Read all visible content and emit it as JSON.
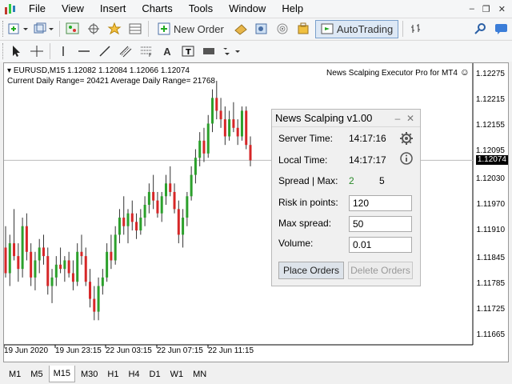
{
  "menubar": {
    "items": [
      "File",
      "View",
      "Insert",
      "Charts",
      "Tools",
      "Window",
      "Help"
    ],
    "win_controls": [
      "‒",
      "❐",
      "✕"
    ]
  },
  "toolbar1": {
    "new_order_label": "New Order",
    "autotrading_label": "AutoTrading"
  },
  "toolbar2": {
    "text_tool_label": "A"
  },
  "chart": {
    "symbol_line": "EURUSD,M15  1.12082 1.12084 1.12066 1.12074",
    "range_line": "Current Daily Range= 20421    Average Daily Range= 21768",
    "ea_label": "News Scalping Executor Pro for MT4",
    "ea_status_icon": "☺",
    "price_ticks": [
      "1.12275",
      "1.12215",
      "1.12155",
      "1.12095",
      "1.12030",
      "1.11970",
      "1.11910",
      "1.11845",
      "1.11785",
      "1.11725",
      "1.11665"
    ],
    "current_price": "1.12074",
    "time_ticks": [
      "19 Jun 2020",
      "19 Jun 23:15",
      "22 Jun 03:15",
      "22 Jun 07:15",
      "22 Jun 11:15"
    ],
    "colors": {
      "bull": "#2ca02c",
      "bear": "#d62728",
      "wick": "#333333",
      "hline": "#bbbbbb"
    }
  },
  "chart_data": {
    "type": "candlestick",
    "ylim": [
      1.11665,
      1.12275
    ],
    "candles": [
      [
        1.1187,
        1.1192,
        1.118,
        1.1181
      ],
      [
        1.1181,
        1.119,
        1.1178,
        1.1188
      ],
      [
        1.1188,
        1.1196,
        1.1184,
        1.1185
      ],
      [
        1.1185,
        1.1188,
        1.1179,
        1.1182
      ],
      [
        1.1182,
        1.1194,
        1.118,
        1.1192
      ],
      [
        1.1192,
        1.1195,
        1.1184,
        1.1186
      ],
      [
        1.1186,
        1.1188,
        1.1178,
        1.118
      ],
      [
        1.118,
        1.1186,
        1.1177,
        1.1184
      ],
      [
        1.1184,
        1.1189,
        1.1181,
        1.1187
      ],
      [
        1.1187,
        1.119,
        1.1183,
        1.1185
      ],
      [
        1.1185,
        1.1187,
        1.1176,
        1.1178
      ],
      [
        1.1178,
        1.1182,
        1.1174,
        1.118
      ],
      [
        1.118,
        1.1185,
        1.1178,
        1.1183
      ],
      [
        1.1183,
        1.1187,
        1.1181,
        1.1182
      ],
      [
        1.1182,
        1.1185,
        1.1179,
        1.1184
      ],
      [
        1.1184,
        1.1186,
        1.118,
        1.1181
      ],
      [
        1.1181,
        1.1184,
        1.1177,
        1.1179
      ],
      [
        1.1179,
        1.1188,
        1.1178,
        1.1186
      ],
      [
        1.1186,
        1.119,
        1.1183,
        1.1185
      ],
      [
        1.1185,
        1.1187,
        1.1178,
        1.1179
      ],
      [
        1.1179,
        1.1182,
        1.1173,
        1.1175
      ],
      [
        1.1175,
        1.1178,
        1.117,
        1.1172
      ],
      [
        1.1172,
        1.118,
        1.117,
        1.1178
      ],
      [
        1.1178,
        1.1182,
        1.1176,
        1.118
      ],
      [
        1.118,
        1.1188,
        1.1179,
        1.1186
      ],
      [
        1.1186,
        1.119,
        1.1182,
        1.1184
      ],
      [
        1.1184,
        1.1192,
        1.1183,
        1.119
      ],
      [
        1.119,
        1.1196,
        1.1188,
        1.1194
      ],
      [
        1.1194,
        1.1199,
        1.119,
        1.1192
      ],
      [
        1.1192,
        1.1196,
        1.1188,
        1.1195
      ],
      [
        1.1195,
        1.1198,
        1.1191,
        1.1193
      ],
      [
        1.1193,
        1.1195,
        1.1189,
        1.1191
      ],
      [
        1.1191,
        1.1196,
        1.119,
        1.1194
      ],
      [
        1.1194,
        1.1199,
        1.1192,
        1.1197
      ],
      [
        1.1197,
        1.1202,
        1.1195,
        1.12
      ],
      [
        1.12,
        1.1204,
        1.1196,
        1.1198
      ],
      [
        1.1198,
        1.12,
        1.1194,
        1.1195
      ],
      [
        1.1195,
        1.12,
        1.1193,
        1.1199
      ],
      [
        1.1199,
        1.1204,
        1.1197,
        1.1202
      ],
      [
        1.1202,
        1.1206,
        1.1199,
        1.12
      ],
      [
        1.12,
        1.1202,
        1.1195,
        1.1196
      ],
      [
        1.1196,
        1.1198,
        1.1188,
        1.119
      ],
      [
        1.119,
        1.1196,
        1.1187,
        1.1194
      ],
      [
        1.1194,
        1.12,
        1.1192,
        1.1199
      ],
      [
        1.1199,
        1.1206,
        1.1198,
        1.1204
      ],
      [
        1.1204,
        1.121,
        1.1202,
        1.1208
      ],
      [
        1.1208,
        1.1214,
        1.1206,
        1.1212
      ],
      [
        1.1212,
        1.1215,
        1.1207,
        1.1209
      ],
      [
        1.1209,
        1.1218,
        1.1208,
        1.1216
      ],
      [
        1.1216,
        1.1224,
        1.1214,
        1.1222
      ],
      [
        1.1222,
        1.1226,
        1.1217,
        1.1219
      ],
      [
        1.1219,
        1.1222,
        1.1215,
        1.1217
      ],
      [
        1.1217,
        1.122,
        1.1211,
        1.1213
      ],
      [
        1.1213,
        1.1219,
        1.1212,
        1.1217
      ],
      [
        1.1217,
        1.1221,
        1.1214,
        1.1215
      ],
      [
        1.1215,
        1.1217,
        1.1211,
        1.1213
      ],
      [
        1.1213,
        1.122,
        1.1212,
        1.1219
      ],
      [
        1.1219,
        1.122,
        1.121,
        1.1211
      ],
      [
        1.1211,
        1.1213,
        1.1206,
        1.12074
      ]
    ]
  },
  "panel": {
    "title": "News Scalping v1.00",
    "minimize": "‒",
    "close": "✕",
    "server_time_label": "Server Time:",
    "server_time": "14:17:16",
    "local_time_label": "Local Time:",
    "local_time": "14:17:17",
    "spread_label": "Spread | Max:",
    "spread_value": "2",
    "spread_max": "5",
    "risk_label": "Risk in points:",
    "risk_value": "120",
    "max_spread_label": "Max spread:",
    "max_spread_value": "50",
    "volume_label": "Volume:",
    "volume_value": "0.01",
    "place_orders": "Place Orders",
    "delete_orders": "Delete Orders"
  },
  "timeframes": [
    "M1",
    "M5",
    "M15",
    "M30",
    "H1",
    "H4",
    "D1",
    "W1",
    "MN"
  ],
  "active_timeframe": "M15"
}
